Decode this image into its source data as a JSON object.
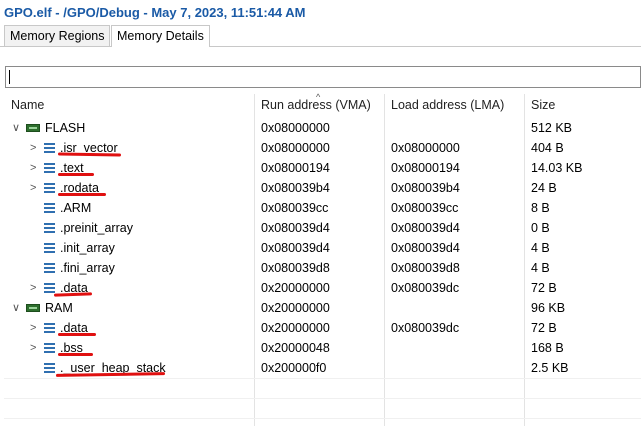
{
  "window": {
    "title": "GPO.elf - /GPO/Debug - May 7, 2023, 11:51:44 AM"
  },
  "tabs": [
    {
      "label": "Memory Regions",
      "active": false
    },
    {
      "label": "Memory Details",
      "active": true
    }
  ],
  "filter": {
    "value": ""
  },
  "columns": {
    "name": "Name",
    "vma": "Run address (VMA)",
    "lma": "Load address (LMA)",
    "size": "Size"
  },
  "rows": [
    {
      "name": "FLASH",
      "vma": "0x08000000",
      "lma": "",
      "size": "512 KB"
    },
    {
      "name": ".isr_vector",
      "vma": "0x08000000",
      "lma": "0x08000000",
      "size": "404 B"
    },
    {
      "name": ".text",
      "vma": "0x08000194",
      "lma": "0x08000194",
      "size": "14.03 KB"
    },
    {
      "name": ".rodata",
      "vma": "0x080039b4",
      "lma": "0x080039b4",
      "size": "24 B"
    },
    {
      "name": ".ARM",
      "vma": "0x080039cc",
      "lma": "0x080039cc",
      "size": "8 B"
    },
    {
      "name": ".preinit_array",
      "vma": "0x080039d4",
      "lma": "0x080039d4",
      "size": "0 B"
    },
    {
      "name": ".init_array",
      "vma": "0x080039d4",
      "lma": "0x080039d4",
      "size": "4 B"
    },
    {
      "name": ".fini_array",
      "vma": "0x080039d8",
      "lma": "0x080039d8",
      "size": "4 B"
    },
    {
      "name": ".data",
      "vma": "0x20000000",
      "lma": "0x080039dc",
      "size": "72 B"
    },
    {
      "name": "RAM",
      "vma": "0x20000000",
      "lma": "",
      "size": "96 KB"
    },
    {
      "name": ".data",
      "vma": "0x20000000",
      "lma": "0x080039dc",
      "size": "72 B"
    },
    {
      "name": ".bss",
      "vma": "0x20000048",
      "lma": "",
      "size": "168 B"
    },
    {
      "name": "._user_heap_stack",
      "vma": "0x200000f0",
      "lma": "",
      "size": "2.5 KB"
    }
  ],
  "colors": {
    "title": "#1a5aa6",
    "annotation": "#e01010",
    "memory_icon": "#2d6e2d",
    "section_icon": "#2f6fb0"
  }
}
